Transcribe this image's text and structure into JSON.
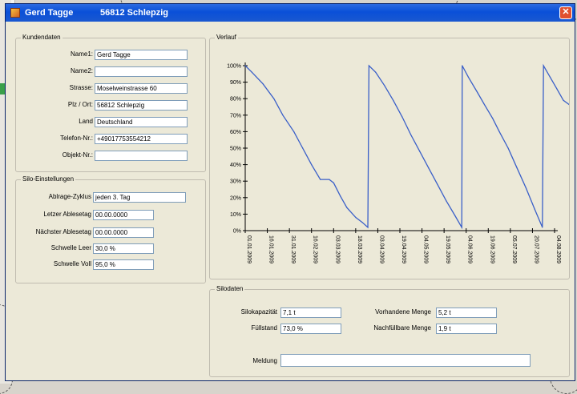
{
  "window": {
    "title_name": "Gerd Tagge",
    "title_place": "56812 Schlepzig",
    "close_glyph": "✕"
  },
  "kundendaten": {
    "title": "Kundendaten",
    "rows": [
      {
        "label": "Name1:",
        "value": "Gerd Tagge"
      },
      {
        "label": "Name2:",
        "value": ""
      },
      {
        "label": "Strasse:",
        "value": "Moselweinstrasse 60"
      },
      {
        "label": "Plz / Ort:",
        "value": "56812 Schlepzig"
      },
      {
        "label": "Land",
        "value": "Deutschland"
      },
      {
        "label": "Telefon-Nr.:",
        "value": "+49017753554212"
      },
      {
        "label": "Objekt-Nr.:",
        "value": ""
      }
    ]
  },
  "silo_einstellungen": {
    "title": "Silo-Einstellungen",
    "rows": [
      {
        "label": "Ablrage-Zyklus",
        "value": "jeden 3. Tag"
      },
      {
        "label": "Letzer Ablesetag",
        "value": "00.00.0000"
      },
      {
        "label": "Nächster Ablesetag",
        "value": "00.00.0000"
      },
      {
        "label": "Schwelle Leer",
        "value": "30,0 %"
      },
      {
        "label": "Schwelle Voll",
        "value": "95,0 %"
      }
    ]
  },
  "verlauf": {
    "title": "Verlauf"
  },
  "silodaten": {
    "title": "Silodaten",
    "silokapazitaet": {
      "label": "Silokapazität",
      "value": "7,1 t"
    },
    "fuellstand": {
      "label": "Füllstand",
      "value": "73,0 %"
    },
    "vorhandene_menge": {
      "label": "Vorhandene Menge",
      "value": "5,2 t"
    },
    "nachfuellbare_menge": {
      "label": "Nachfüllbare Menge",
      "value": "1,9 t"
    },
    "meldung": {
      "label": "Meldung",
      "value": ""
    }
  },
  "chart_data": {
    "type": "line",
    "y_ticks": [
      "0%",
      "10%",
      "20%",
      "30%",
      "40%",
      "50%",
      "60%",
      "70%",
      "80%",
      "90%",
      "100%"
    ],
    "ylim": [
      0,
      100
    ],
    "x_ticks": [
      "01.01.2009",
      "16.01.2009",
      "31.01.2009",
      "16.02.2009",
      "03.03.2009",
      "18.03.2009",
      "03.04.2009",
      "19.04.2009",
      "04.05.2009",
      "19.05.2009",
      "04.06.2009",
      "19.06.2009",
      "05.07.2009",
      "20.07.2009",
      "04.08.2009"
    ],
    "series": [
      {
        "color": "#3a5fc8",
        "points": [
          [
            0,
            100
          ],
          [
            0.3,
            96
          ],
          [
            0.8,
            89
          ],
          [
            1.3,
            80
          ],
          [
            1.7,
            70
          ],
          [
            2.2,
            60
          ],
          [
            2.6,
            50
          ],
          [
            3.0,
            40
          ],
          [
            3.4,
            31
          ],
          [
            3.8,
            31
          ],
          [
            4.0,
            29
          ],
          [
            4.3,
            21
          ],
          [
            4.6,
            14
          ],
          [
            5.0,
            8
          ],
          [
            5.3,
            5
          ],
          [
            5.55,
            2
          ],
          [
            5.6,
            100
          ],
          [
            5.9,
            96
          ],
          [
            6.3,
            88
          ],
          [
            6.7,
            79
          ],
          [
            7.1,
            69
          ],
          [
            7.5,
            58
          ],
          [
            7.9,
            48
          ],
          [
            8.3,
            38
          ],
          [
            8.7,
            28
          ],
          [
            9.1,
            18
          ],
          [
            9.5,
            9
          ],
          [
            9.8,
            2
          ],
          [
            9.82,
            100
          ],
          [
            10.1,
            93
          ],
          [
            10.5,
            84
          ],
          [
            10.8,
            77
          ],
          [
            11.2,
            68
          ],
          [
            11.5,
            60
          ],
          [
            11.9,
            50
          ],
          [
            12.3,
            38
          ],
          [
            12.7,
            26
          ],
          [
            13.1,
            13
          ],
          [
            13.45,
            2
          ],
          [
            13.5,
            100
          ],
          [
            13.8,
            93
          ],
          [
            14.1,
            86
          ],
          [
            14.4,
            79
          ],
          [
            14.7,
            76
          ],
          [
            15.0,
            72
          ],
          [
            15.2,
            66
          ],
          [
            15.3,
            63
          ]
        ]
      }
    ],
    "grid": false
  }
}
